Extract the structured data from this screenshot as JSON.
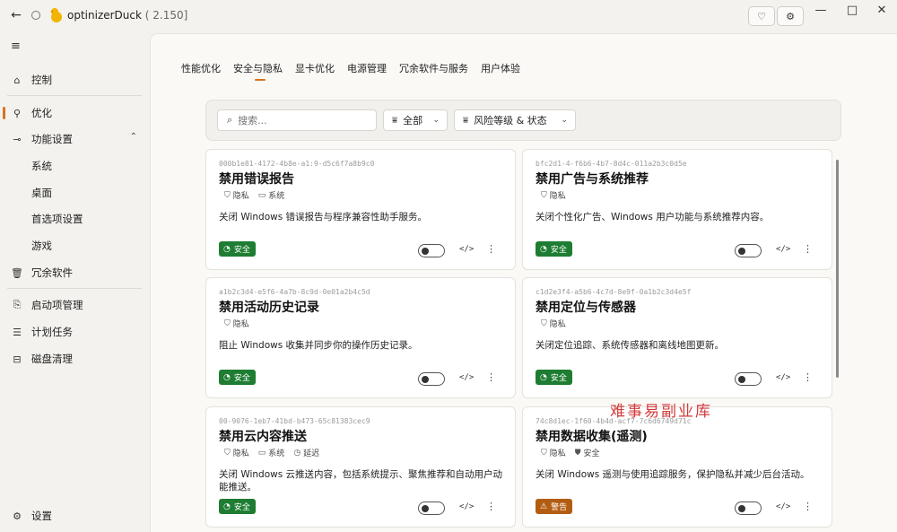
{
  "titlebar": {
    "app_name": "optinizerDuck",
    "version": "( 2.150]",
    "back_icon": "arrow-left-icon",
    "win_min": "—",
    "win_max": "□",
    "win_close": "✕"
  },
  "sidebar": {
    "items": [
      {
        "label": "控制",
        "icon": "home-icon"
      },
      {
        "label": "优化",
        "icon": "tune-icon"
      },
      {
        "label": "功能设置",
        "icon": "toggle-icon"
      },
      {
        "label": "系统"
      },
      {
        "label": "桌面"
      },
      {
        "label": "首选项设置"
      },
      {
        "label": "游戏"
      },
      {
        "label": "冗余软件",
        "icon": "trash-icon"
      },
      {
        "label": "启动项管理",
        "icon": "startup-icon"
      },
      {
        "label": "计划任务",
        "icon": "list-icon"
      },
      {
        "label": "磁盘清理",
        "icon": "disk-icon"
      },
      {
        "label": "设置",
        "icon": "gear-icon"
      }
    ]
  },
  "tabs": [
    "性能优化",
    "安全与隐私",
    "显卡优化",
    "电源管理",
    "冗余软件与服务",
    "用户体验"
  ],
  "active_tab": "安全与隐私",
  "filters": {
    "search_placeholder": "搜索...",
    "category": "全部",
    "risk_status": "风险等级 & 状态"
  },
  "cards": [
    {
      "id": "000b1e81-4172-4b8e-a1:9-d5c6f7a8b9c0",
      "title": "禁用错误报告",
      "tags": [
        {
          "icon": "privacy-icon",
          "label": "隐私"
        },
        {
          "icon": "monitor-icon",
          "label": "系统"
        }
      ],
      "description": "关闭 Windows 错误报告与程序兼容性助手服务。",
      "badge": "安全",
      "level": "safe"
    },
    {
      "id": "bfc2d1-4-f6b6-4b7-8d4c-011a2b3c0d5e",
      "title": "禁用广告与系统推荐",
      "tags": [
        {
          "icon": "privacy-icon",
          "label": "隐私"
        }
      ],
      "description": "关闭个性化广告、Windows 用户功能与系统推荐内容。",
      "badge": "安全",
      "level": "safe"
    },
    {
      "id": "a1b2c3d4-e5f6-4a7b-8c9d-0e01a2b4c5d",
      "title": "禁用活动历史记录",
      "tags": [
        {
          "icon": "privacy-icon",
          "label": "隐私"
        }
      ],
      "description": "阻止 Windows 收集并同步你的操作历史记录。",
      "badge": "安全",
      "level": "safe"
    },
    {
      "id": "c1d2e3f4-a5b6-4c7d-8e9f-0a1b2c3d4e5f",
      "title": "禁用定位与传感器",
      "tags": [
        {
          "icon": "privacy-icon",
          "label": "隐私"
        }
      ],
      "description": "关闭定位追踪、系统传感器和离线地图更新。",
      "badge": "安全",
      "level": "safe"
    },
    {
      "id": "00-9076-1eb7-41bd-b473-65c81383cec9",
      "title": "禁用云内容推送",
      "tags": [
        {
          "icon": "privacy-icon",
          "label": "隐私"
        },
        {
          "icon": "monitor-icon",
          "label": "系统"
        },
        {
          "icon": "clock-icon",
          "label": "延迟"
        }
      ],
      "description": "关闭 Windows 云推送内容，包括系统提示、聚焦推荐和自动用户动能推送。",
      "badge": "安全",
      "level": "safe"
    },
    {
      "id": "74c8d1ec-1f60-4b4d-acf7-7c6d6749d71c",
      "title": "禁用数据收集(遥测)",
      "tags": [
        {
          "icon": "privacy-icon",
          "label": "隐私"
        },
        {
          "icon": "shield-icon",
          "label": "安全"
        }
      ],
      "description": "关闭 Windows 遥测与使用追踪服务，保护隐私并减少后台活动。",
      "badge": "警告",
      "level": "warn"
    }
  ],
  "colors": {
    "accent": "#d9731f",
    "safe": "#1e7d32",
    "warn": "#b35d12"
  },
  "watermark": "难事易副业库"
}
